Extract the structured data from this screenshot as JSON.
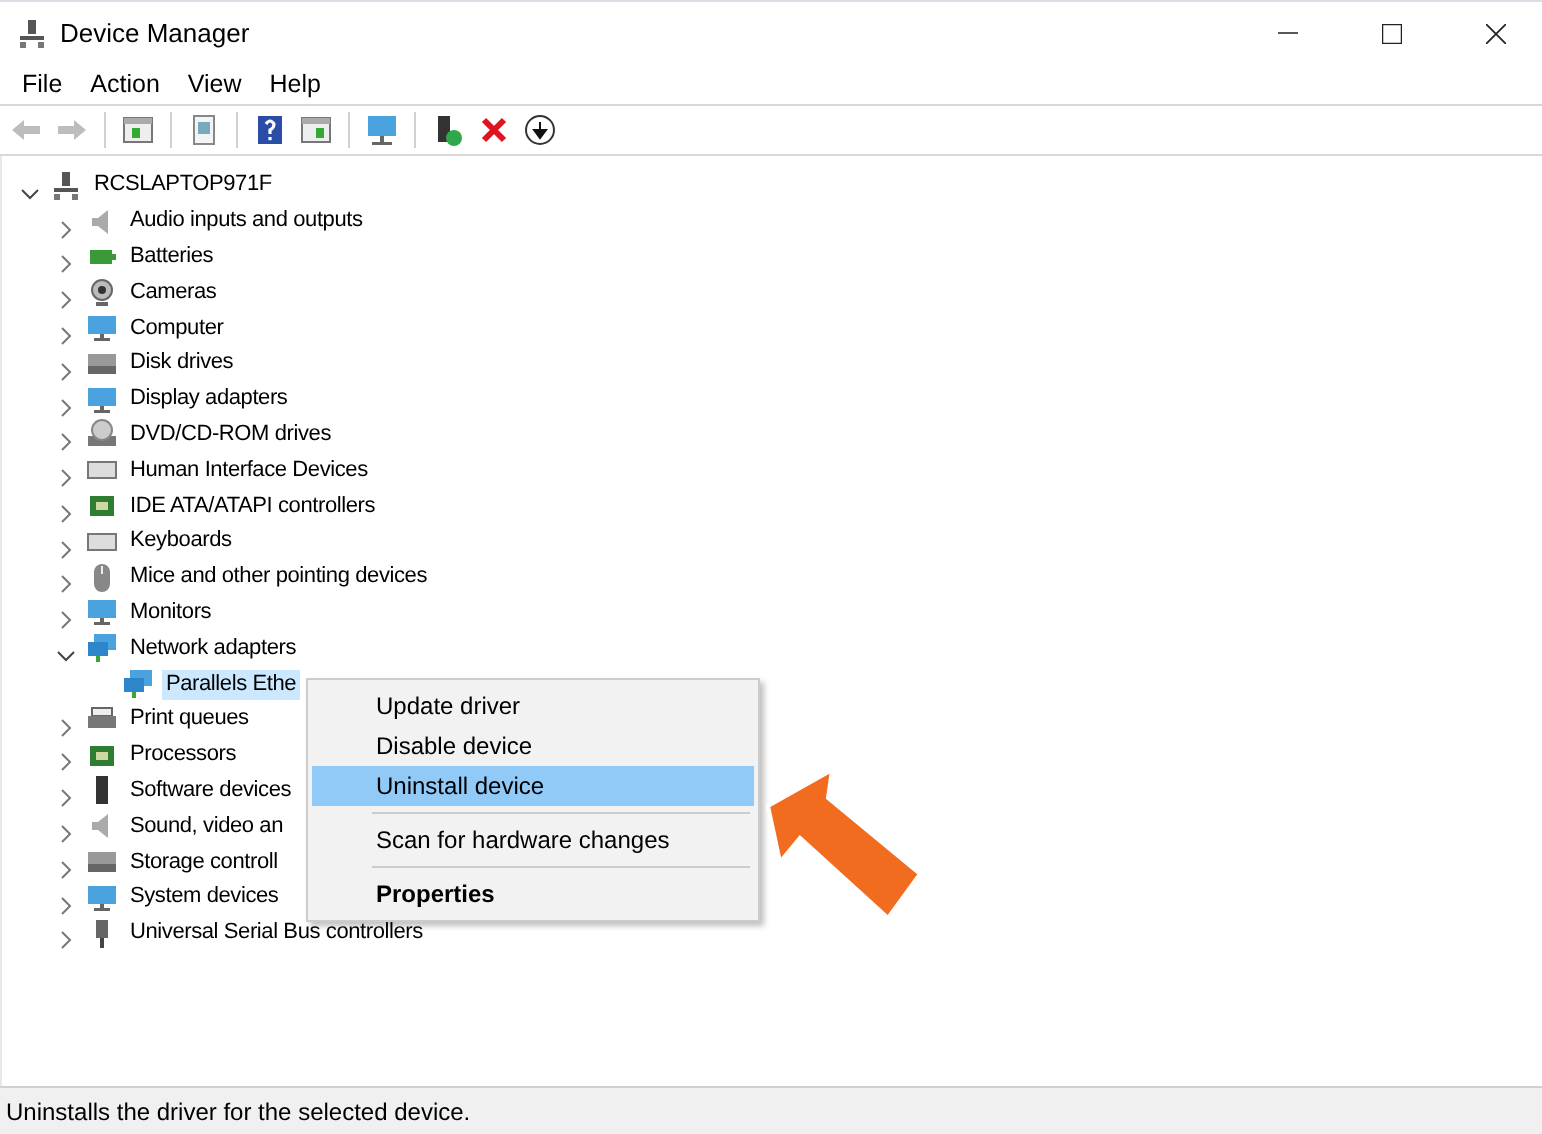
{
  "window": {
    "title": "Device Manager"
  },
  "menu_bar": [
    "File",
    "Action",
    "View",
    "Help"
  ],
  "toolbar": [
    {
      "kind": "back",
      "disabled": true
    },
    {
      "kind": "forward",
      "disabled": true
    },
    {
      "kind": "separator"
    },
    {
      "kind": "console",
      "disabled": false
    },
    {
      "kind": "separator"
    },
    {
      "kind": "properties",
      "disabled": false
    },
    {
      "kind": "separator"
    },
    {
      "kind": "help",
      "disabled": false
    },
    {
      "kind": "pane",
      "disabled": false
    },
    {
      "kind": "separator"
    },
    {
      "kind": "scan",
      "disabled": false
    },
    {
      "kind": "separator"
    },
    {
      "kind": "update",
      "disabled": false
    },
    {
      "kind": "remove",
      "disabled": false
    },
    {
      "kind": "download",
      "disabled": false
    }
  ],
  "tree": {
    "label": "RCSLAPTOP971F",
    "expanded": true,
    "selected": false,
    "children": [
      {
        "label": "Audio inputs and outputs",
        "expanded": false,
        "selected": false
      },
      {
        "label": "Batteries",
        "expanded": false,
        "selected": false
      },
      {
        "label": "Cameras",
        "expanded": false,
        "selected": false
      },
      {
        "label": "Computer",
        "expanded": false,
        "selected": false
      },
      {
        "label": "Disk drives",
        "expanded": false,
        "selected": false
      },
      {
        "label": "Display adapters",
        "expanded": false,
        "selected": false
      },
      {
        "label": "DVD/CD-ROM drives",
        "expanded": false,
        "selected": false
      },
      {
        "label": "Human Interface Devices",
        "expanded": false,
        "selected": false
      },
      {
        "label": "IDE ATA/ATAPI controllers",
        "expanded": false,
        "selected": false
      },
      {
        "label": "Keyboards",
        "expanded": false,
        "selected": false
      },
      {
        "label": "Mice and other pointing devices",
        "expanded": false,
        "selected": false
      },
      {
        "label": "Monitors",
        "expanded": false,
        "selected": false
      },
      {
        "label": "Network adapters",
        "expanded": true,
        "selected": false,
        "children": [
          {
            "label": "Parallels Ethe",
            "selected": true
          }
        ]
      },
      {
        "label": "Print queues",
        "expanded": false,
        "selected": false
      },
      {
        "label": "Processors",
        "expanded": false,
        "selected": false
      },
      {
        "label": "Software devices",
        "expanded": false,
        "selected": false
      },
      {
        "label": "Sound, video an",
        "expanded": false,
        "selected": false
      },
      {
        "label": "Storage controll",
        "expanded": false,
        "selected": false
      },
      {
        "label": "System devices",
        "expanded": false,
        "selected": false
      },
      {
        "label": "Universal Serial Bus controllers",
        "expanded": false,
        "selected": false
      }
    ]
  },
  "context_menu": [
    {
      "kind": "item",
      "label": "Update driver",
      "selected": false,
      "default": false
    },
    {
      "kind": "item",
      "label": "Disable device",
      "selected": false,
      "default": false
    },
    {
      "kind": "item",
      "label": "Uninstall device",
      "selected": true,
      "default": false
    },
    {
      "kind": "separator"
    },
    {
      "kind": "item",
      "label": "Scan for hardware changes",
      "selected": false,
      "default": false
    },
    {
      "kind": "separator"
    },
    {
      "kind": "item",
      "label": "Properties",
      "selected": false,
      "default": true
    }
  ],
  "status_bar": "Uninstalls the driver for the selected device."
}
